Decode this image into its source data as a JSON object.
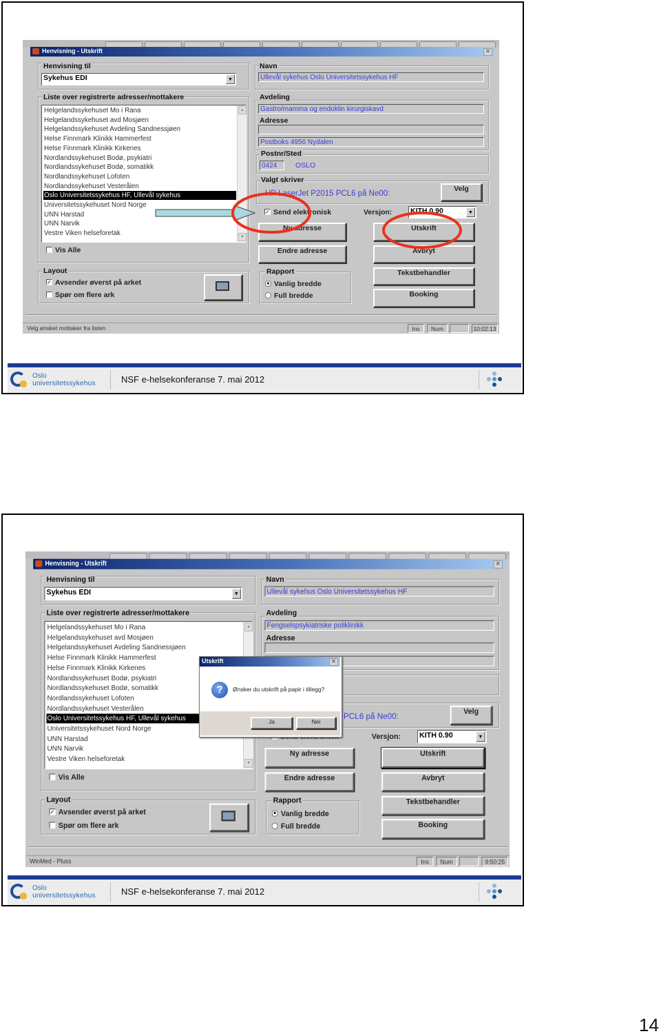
{
  "page_number": "14",
  "footer": {
    "logo_line1": "Oslo",
    "logo_line2": "universitetssykehus",
    "title": "NSF e-helsekonferanse 7. mai 2012",
    "brand_color": "#1d3c96"
  },
  "slides": [
    {
      "dialog": {
        "title": "Henvisning - Utskrift",
        "henvisning_label": "Henvisning til",
        "henvisning_value": "Sykehus EDI",
        "list_label": "Liste over registrerte adresser/mottakere",
        "list_items": [
          "Helgelandssykehuset  Mo i Rana",
          "Helgelandssykehuset avd Mosjøen",
          "Helgelandssykehuset Avdeling Sandnessjøen",
          "Helse Finnmark Klinikk Hammerfest",
          "Helse Finnmark Klinikk Kirkenes",
          "Nordlandssykehuset Bodø, psykiatri",
          "Nordlandssykehuset Bodø, somatikk",
          "Nordlandssykehuset Lofoten",
          "Nordlandssykehuset Vesterålen",
          "Oslo Universitetssykehus HF, Ullevål sykehus",
          "Universitetssykehuset Nord Norge",
          "UNN Harstad",
          "UNN Narvik",
          "Vestre Viken helseforetak"
        ],
        "selected_index": 9,
        "vis_alle_label": "Vis Alle",
        "vis_alle_checked": false,
        "layout_label": "Layout",
        "avsender_label": "Avsender øverst på arket",
        "avsender_checked": true,
        "spor_label": "Spør om flere ark",
        "spor_checked": false,
        "navn_label": "Navn",
        "navn_value": "Ullevål sykehus Oslo Universitetssykehus HF",
        "avdeling_label": "Avdeling",
        "avdeling_value": "Gastro/mamma og endoklin kirurgiskavd",
        "adresse_label": "Adresse",
        "adresse_line1": "",
        "adresse_line2": "Postboks 4956 Nydalen",
        "postnr_label": "Postnr/Sted",
        "postnr_value": "0424",
        "sted_value": "OSLO",
        "skriver_label": "Valgt skriver",
        "skriver_value": "HP LaserJet P2015 PCL6 på Ne00:",
        "velg_label": "Velg",
        "send_label": "Send elektronisk",
        "send_checked": true,
        "versjon_label": "Versjon:",
        "versjon_value": "KITH 0.90",
        "ny_adresse_label": "Ny adresse",
        "endre_adresse_label": "Endre adresse",
        "utskrift_label": "Utskrift",
        "avbryt_label": "Avbryt",
        "tekstbehandler_label": "Tekstbehandler",
        "booking_label": "Booking",
        "rapport_label": "Rapport",
        "vanlig_label": "Vanlig bredde",
        "full_label": "Full bredde",
        "rapport_selected": "Vanlig bredde",
        "status_text": "Velg ønsket mottaker fra listen",
        "status_ins": "Ins",
        "status_num": "Num",
        "status_time": "10:02:13"
      },
      "annotations": {
        "ellipse_color": "#e8321e",
        "arrow_color": "#a9d8e0"
      }
    },
    {
      "dialog": {
        "title": "Henvisning - Utskrift",
        "henvisning_label": "Henvisning til",
        "henvisning_value": "Sykehus EDI",
        "list_label": "Liste over registrerte adresser/mottakere",
        "list_items": [
          "Helgelandssykehuset  Mo i Rana",
          "Helgelandssykehuset avd Mosjøen",
          "Helgelandssykehuset Avdeling Sandnessjøen",
          "Helse Finnmark Klinikk Hammerfest",
          "Helse Finnmark Klinikk Kirkenes",
          "Nordlandssykehuset Bodø, psykiatri",
          "Nordlandssykehuset Bodø, somatikk",
          "Nordlandssykehuset Lofoten",
          "Nordlandssykehuset Vesterålen",
          "Oslo Universitetssykehus HF, Ullevål sykehus",
          "Universitetssykehuset Nord Norge",
          "UNN Harstad",
          "UNN Narvik",
          "Vestre Viken helseforetak"
        ],
        "selected_index": 9,
        "vis_alle_label": "Vis Alle",
        "vis_alle_checked": false,
        "layout_label": "Layout",
        "avsender_label": "Avsender øverst på arket",
        "avsender_checked": true,
        "spor_label": "Spør om flere ark",
        "spor_checked": false,
        "navn_label": "Navn",
        "navn_value": "Ullevål sykehus Oslo Universitetssykehus HF",
        "avdeling_label": "Avdeling",
        "avdeling_value": "Fengselspsykiatriske poliklinikk",
        "adresse_label": "Adresse",
        "adresse_line1": "",
        "adresse_line2": "",
        "postnr_label": "",
        "postnr_value": "",
        "sted_value": "",
        "skriver_label": "",
        "skriver_value": "HP LaserJet P2015 PCL6 på Ne00:",
        "velg_label": "Velg",
        "send_label": "Send elektronisk",
        "send_checked": true,
        "versjon_label": "Versjon:",
        "versjon_value": "KITH 0.90",
        "ny_adresse_label": "Ny adresse",
        "endre_adresse_label": "Endre adresse",
        "utskrift_label": "Utskrift",
        "avbryt_label": "Avbryt",
        "tekstbehandler_label": "Tekstbehandler",
        "booking_label": "Booking",
        "rapport_label": "Rapport",
        "vanlig_label": "Vanlig bredde",
        "full_label": "Full bredde",
        "rapport_selected": "Vanlig bredde",
        "status_text": "WinMed - Pluss",
        "status_ins": "Ins",
        "status_num": "Num",
        "status_time": "9:50:25"
      },
      "popup": {
        "title": "Utskrift",
        "icon": "question-icon",
        "message": "Ønsker du utskrift på papir i tillegg?",
        "yes_label": "Ja",
        "no_label": "Nei"
      }
    }
  ]
}
